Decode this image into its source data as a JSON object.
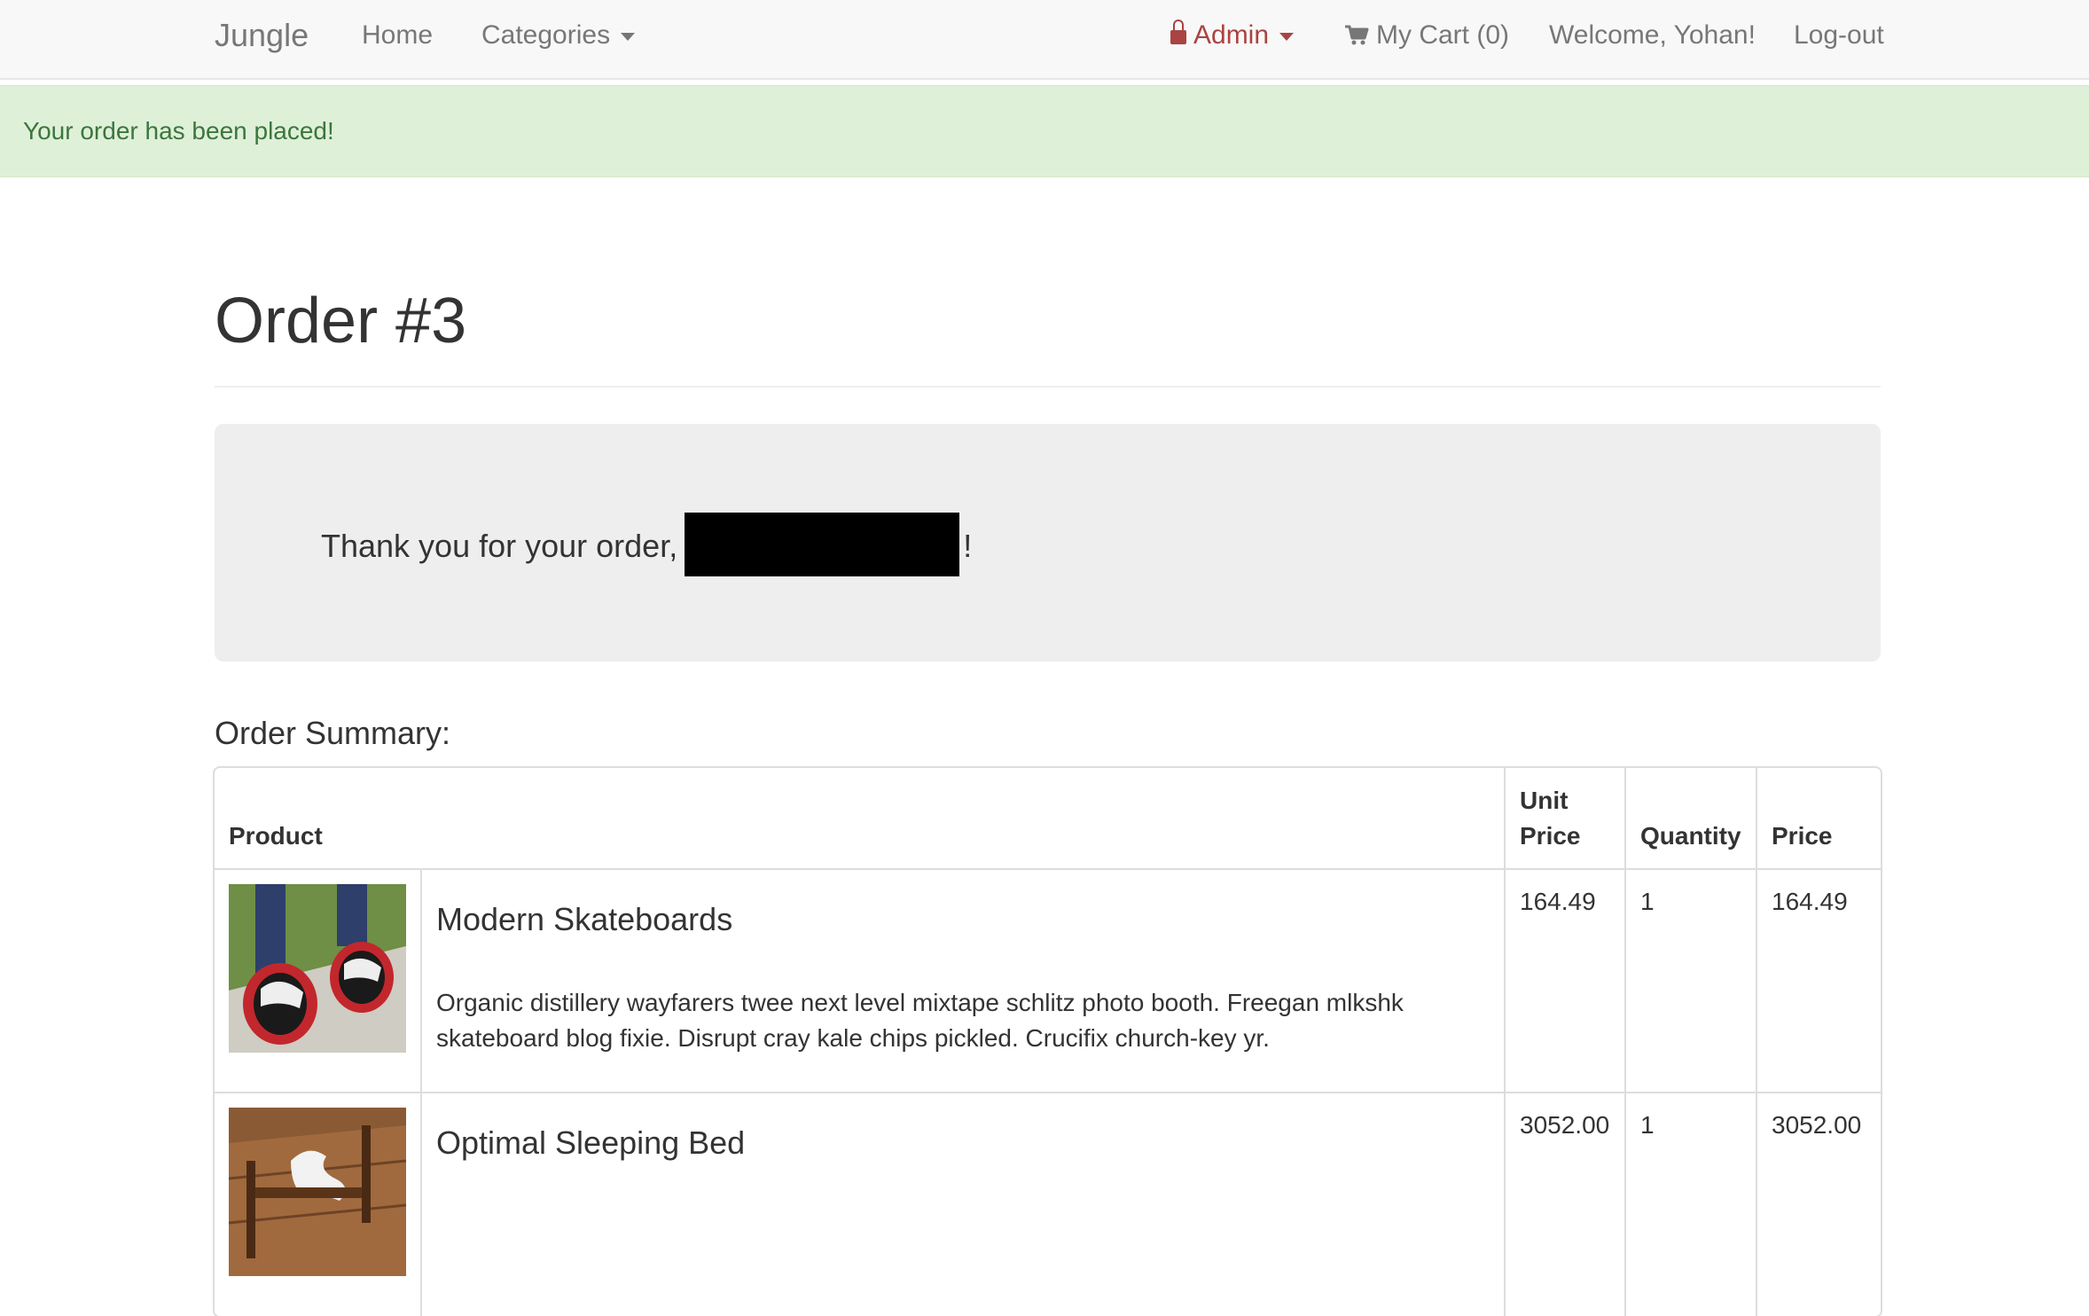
{
  "navbar": {
    "brand": "Jungle",
    "home": "Home",
    "categories": "Categories",
    "admin": "Admin",
    "cart": "My Cart (0)",
    "welcome": "Welcome, Yohan!",
    "logout": "Log-out"
  },
  "alert": {
    "message": "Your order has been placed!"
  },
  "order": {
    "title": "Order #3",
    "thanks_prefix": "Thank you for your order,",
    "thanks_suffix": "!"
  },
  "summary": {
    "heading": "Order Summary:",
    "columns": {
      "product": "Product",
      "unit_price": "Unit Price",
      "quantity": "Quantity",
      "price": "Price"
    },
    "items": [
      {
        "name": "Modern Skateboards",
        "description": "Organic distillery wayfarers twee next level mixtape schlitz photo booth. Freegan mlkshk skateboard blog fixie. Disrupt cray kale chips pickled. Crucifix church-key yr.",
        "unit_price": "164.49",
        "quantity": "1",
        "price": "164.49"
      },
      {
        "name": "Optimal Sleeping Bed",
        "description": "",
        "unit_price": "3052.00",
        "quantity": "1",
        "price": "3052.00"
      }
    ]
  },
  "colors": {
    "navbar_bg": "#f8f8f8",
    "admin_red": "#a94442",
    "alert_bg": "#dff0d8",
    "alert_text": "#3c763d",
    "jumbotron_bg": "#eeeeee"
  },
  "icons": {
    "admin": "lock-icon",
    "cart": "shopping-cart-icon",
    "dropdown": "caret-down-icon"
  }
}
